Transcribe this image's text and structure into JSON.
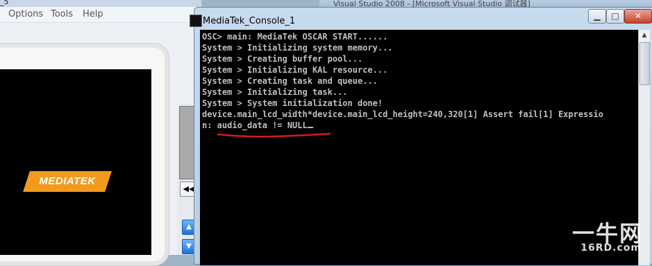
{
  "simulator": {
    "title_fragment": "_5",
    "menu": [
      "Options",
      "Tools",
      "Help"
    ],
    "logo_text": "MEDIATEK"
  },
  "background_window": {
    "title_fragment": "Visual Studio 2008 - [Microsoft Visual Studio 调试器]"
  },
  "console": {
    "title": "MediaTek_Console_1",
    "lines": [
      "OSC> main: MediaTek OSCAR START......",
      "System > Initializing system memory...",
      "System > Creating buffer pool...",
      "System > Initializing KAL resource...",
      "System > Creating task and queue...",
      "System > Initializing task...",
      "System > System initialization done!",
      "device.main_lcd_width*device.main_lcd_height=240,320[1] Assert fail[1] Expressio",
      "n: audio_data != NULL"
    ]
  },
  "watermark": {
    "cn": "一牛网",
    "url": "16RD.com"
  },
  "colors": {
    "console_bg": "#000000",
    "console_text": "#c0c0c0",
    "mtk_orange": "#f39a1c",
    "annotation_red": "#d11c1c"
  }
}
